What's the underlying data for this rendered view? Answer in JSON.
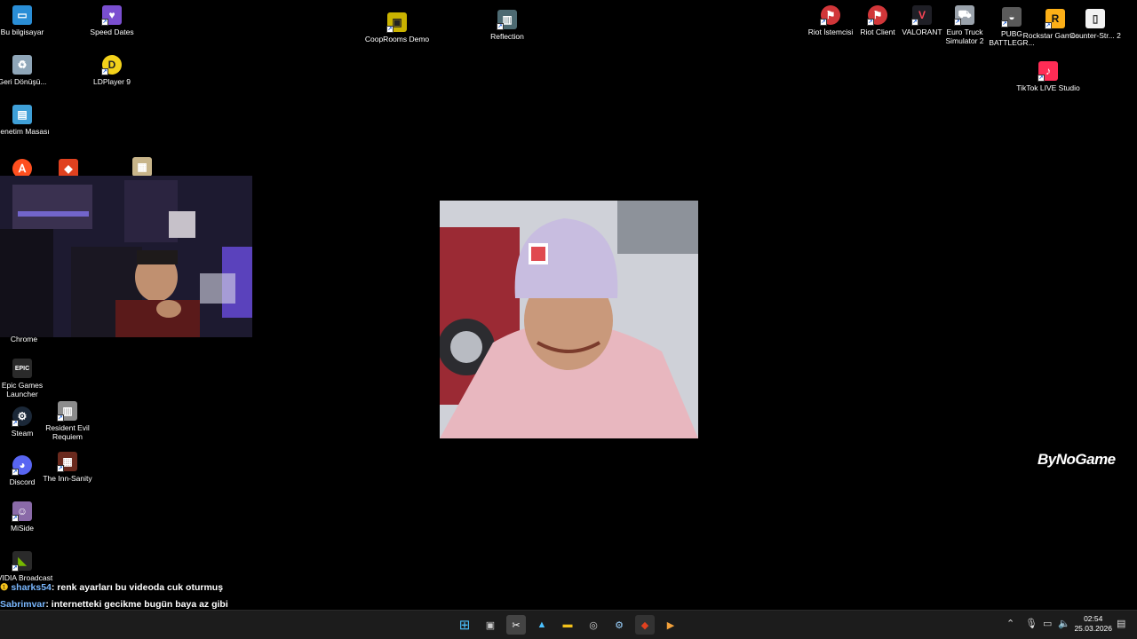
{
  "desktop_icons": {
    "bu_bilgisayar": "Bu bilgisayar",
    "speed_dates": "Speed Dates",
    "geri_donusum": "Geri Dönüşü...",
    "ldplayer": "LDPlayer 9",
    "denetim_masasi": "Denetim Masası",
    "cooprooms": "CoopRooms Demo",
    "reflection": "Reflection",
    "riot_istemcisi": "Riot İstemcisi",
    "riot_client": "Riot Client",
    "valorant": "VALORANT",
    "euro_truck": "Euro Truck Simulator 2",
    "pubg": "PUBG BATTLEGR...",
    "rockstar": "Rockstar Games ...",
    "counter_strike": "Counter-Str... 2",
    "tiktok_live": "TikTok LIVE Studio",
    "chrome": "Chrome",
    "epic": "Epic Games Launcher",
    "steam": "Steam",
    "resident_evil": "Resident Evil Requiem",
    "discord": "Discord",
    "inn_sanity": "The Inn-Sanity",
    "miside": "MiSide",
    "nvidia": "NVIDIA Broadcast"
  },
  "overlay": {
    "brand": "ByNoGame"
  },
  "chat": [
    {
      "user": "sharks54",
      "message": ": renk ayarları bu videoda cuk oturmuş"
    },
    {
      "user": "Sabrimvar",
      "message": ": internetteki gecikme bugün baya az gibi"
    }
  ],
  "taskbar": {
    "time": "02:54",
    "date": "25.03.2026"
  },
  "colors": {
    "riot": "#d13639",
    "valorant": "#fd4556",
    "rockstar": "#fcaf17",
    "steam": "#1b2838",
    "discord": "#5865f2",
    "nvidia": "#76b900",
    "taskbar_bg": "#1c1c1c"
  }
}
